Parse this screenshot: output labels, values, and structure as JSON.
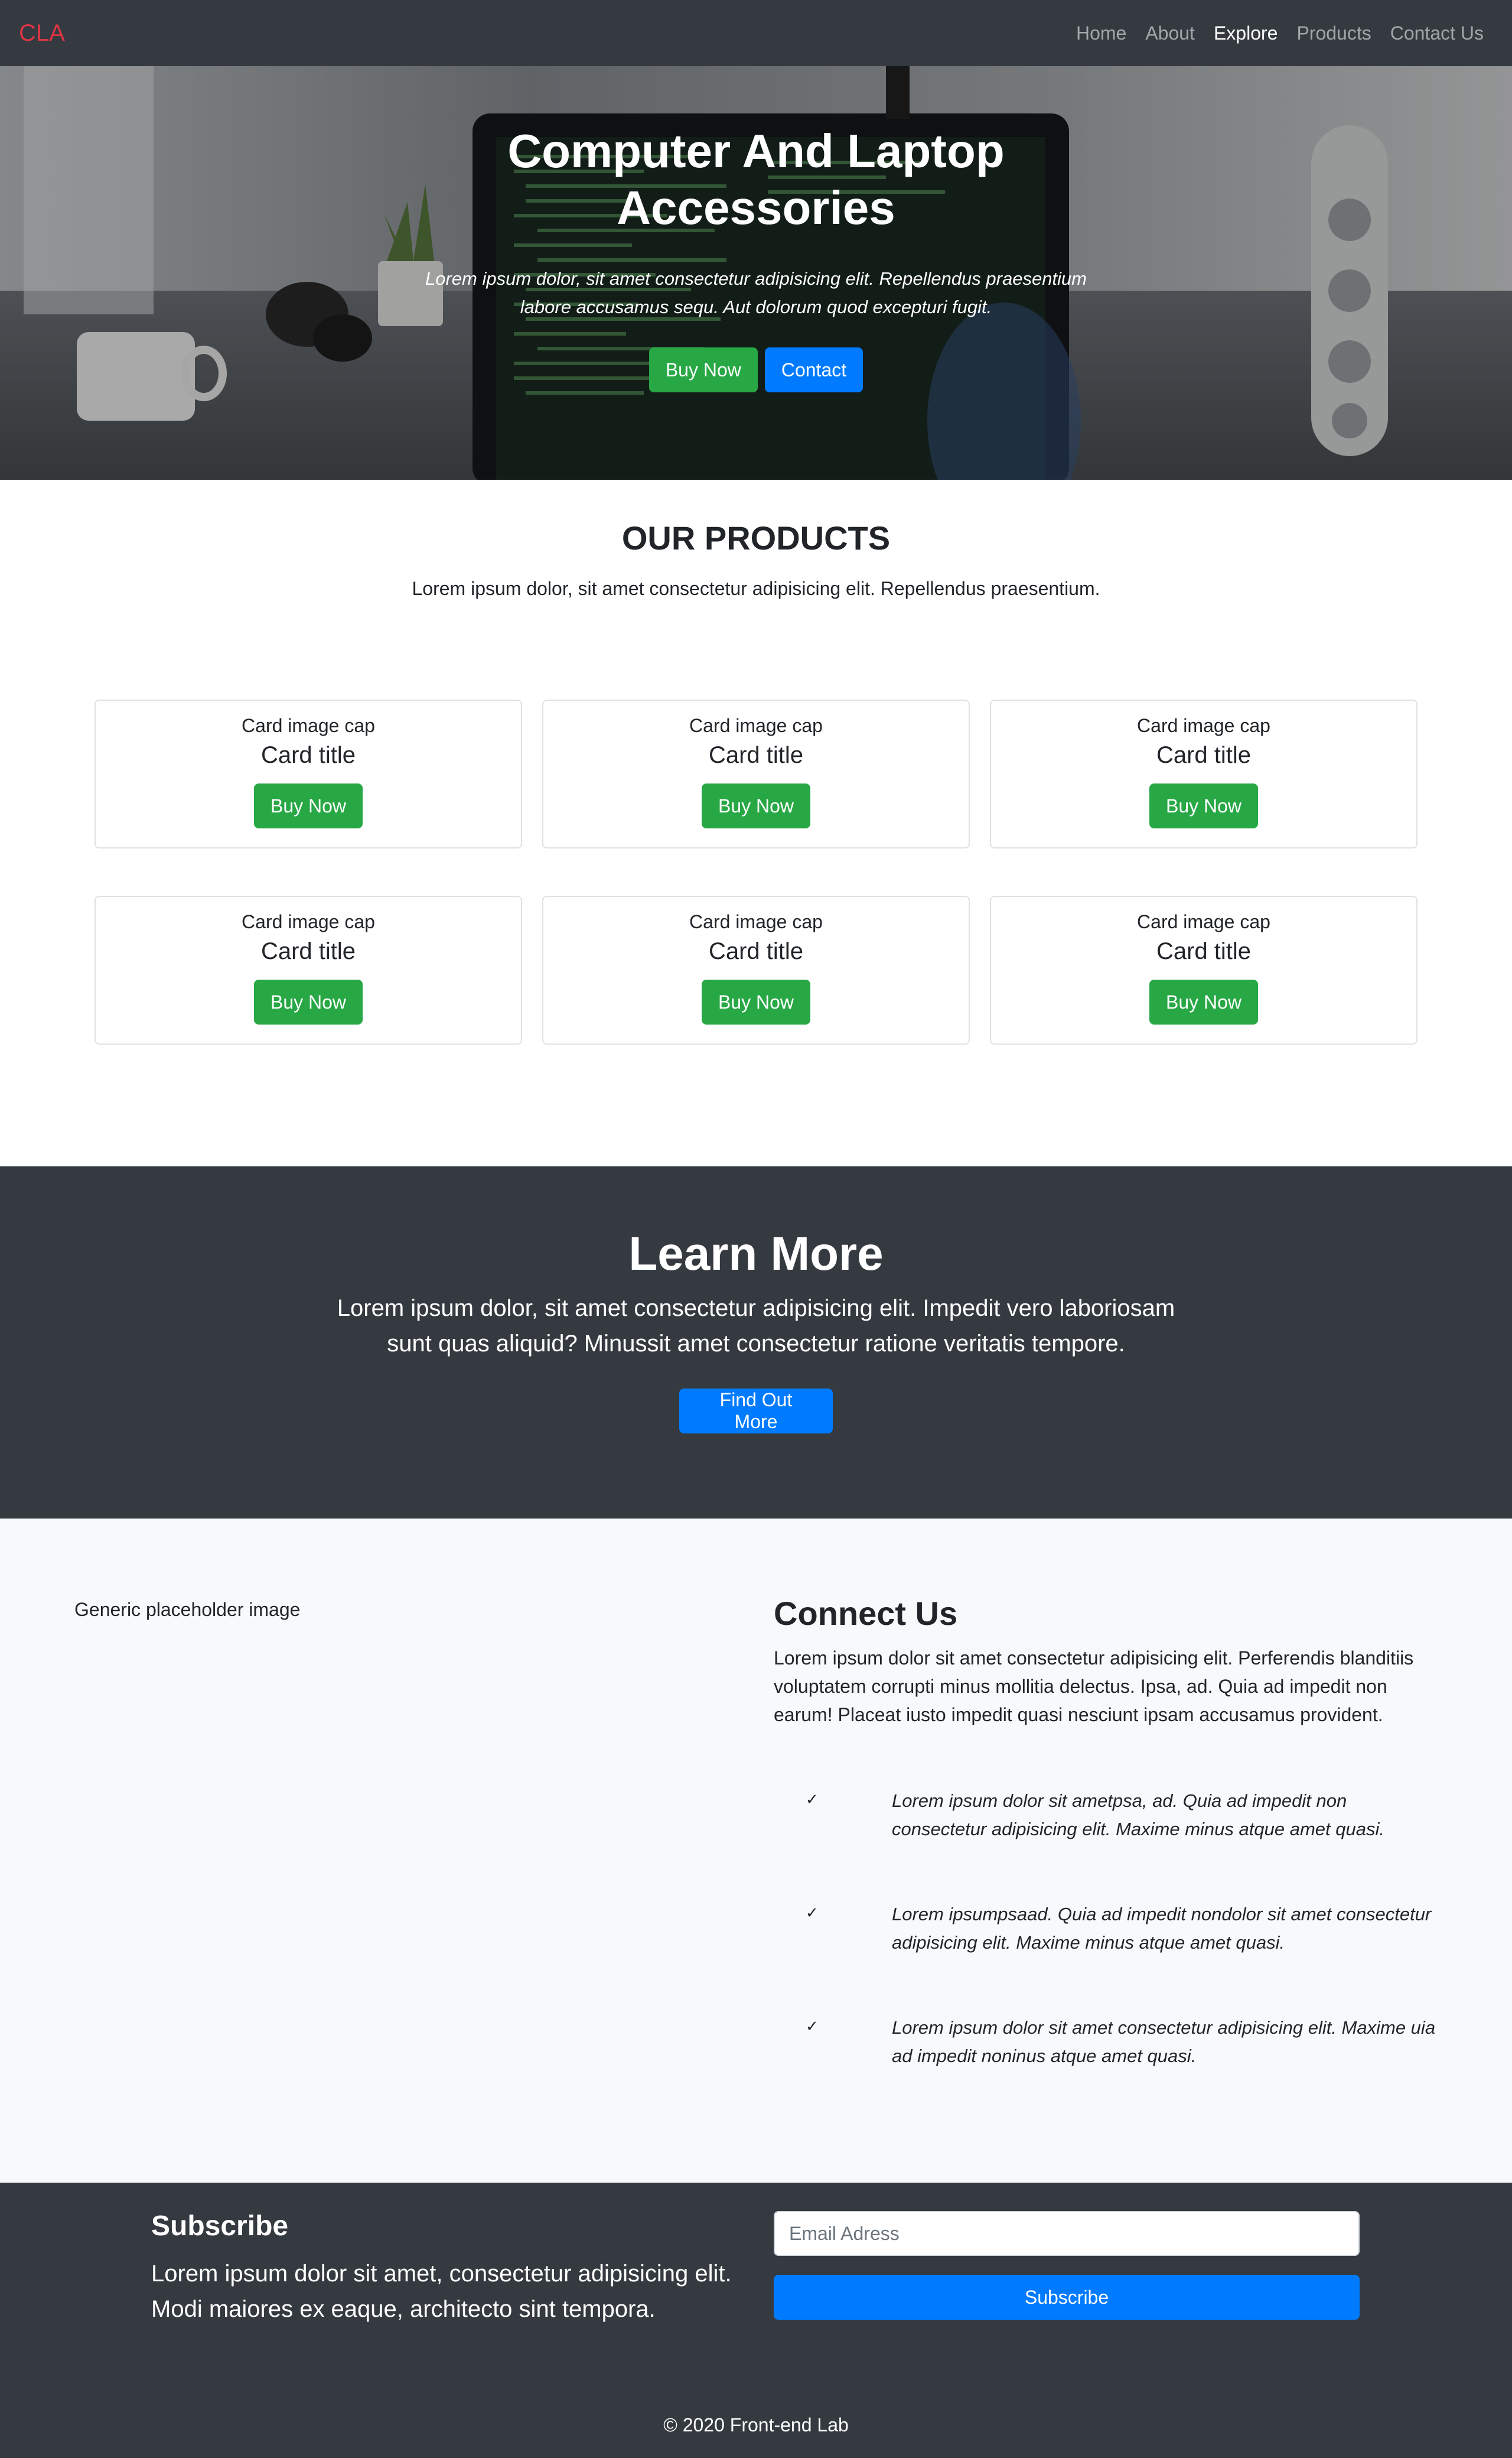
{
  "navbar": {
    "brand": "CLA",
    "links": [
      "Home",
      "About",
      "Explore",
      "Products",
      "Contact Us"
    ],
    "active_link": "Explore"
  },
  "hero": {
    "title": "Computer And Laptop Accessories",
    "text": "Lorem ipsum dolor, sit amet consectetur adipisicing elit. Repellendus praesentium labore accusamus sequ. Aut dolorum quod excepturi fugit.",
    "buy_label": "Buy Now",
    "contact_label": "Contact"
  },
  "products": {
    "title": "OUR PRODUCTS",
    "subtitle": "Lorem ipsum dolor, sit amet consectetur adipisicing elit. Repellendus praesentium.",
    "cards": [
      {
        "cap": "Card image cap",
        "title": "Card title",
        "button": "Buy Now"
      },
      {
        "cap": "Card image cap",
        "title": "Card title",
        "button": "Buy Now"
      },
      {
        "cap": "Card image cap",
        "title": "Card title",
        "button": "Buy Now"
      },
      {
        "cap": "Card image cap",
        "title": "Card title",
        "button": "Buy Now"
      },
      {
        "cap": "Card image cap",
        "title": "Card title",
        "button": "Buy Now"
      },
      {
        "cap": "Card image cap",
        "title": "Card title",
        "button": "Buy Now"
      }
    ]
  },
  "learn_more": {
    "title": "Learn More",
    "text": "Lorem ipsum dolor, sit amet consectetur adipisicing elit. Impedit vero laboriosam sunt quas aliquid? Minussit amet consectetur ratione veritatis tempore.",
    "button": "Find Out More"
  },
  "connect": {
    "image_alt": "Generic placeholder image",
    "title": "Connect Us",
    "text": "Lorem ipsum dolor sit amet consectetur adipisicing elit. Perferendis blanditiis voluptatem corrupti minus mollitia delectus. Ipsa, ad. Quia ad impedit non earum! Placeat iusto impedit quasi nesciunt ipsam accusamus provident.",
    "features": [
      "Lorem ipsum dolor sit ametpsa, ad. Quia ad impedit non consectetur adipisicing elit. Maxime minus atque amet quasi.",
      "Lorem ipsumpsaad. Quia ad impedit nondolor sit amet consectetur adipisicing elit. Maxime minus atque amet quasi.",
      "Lorem ipsum dolor sit amet consectetur adipisicing elit. Maxime uia ad impedit noninus atque amet quasi."
    ]
  },
  "subscribe": {
    "title": "Subscribe",
    "text": "Lorem ipsum dolor sit amet, consectetur adipisicing elit. Modi maiores ex eaque, architecto sint tempora.",
    "email_placeholder": "Email Adress",
    "button": "Subscribe"
  },
  "footer": {
    "copyright": "© 2020 Front-end Lab"
  },
  "colors": {
    "dark": "#343a40",
    "light": "#f8f9fa",
    "success": "#28a745",
    "primary": "#007bff",
    "brand": "#dc3545"
  }
}
